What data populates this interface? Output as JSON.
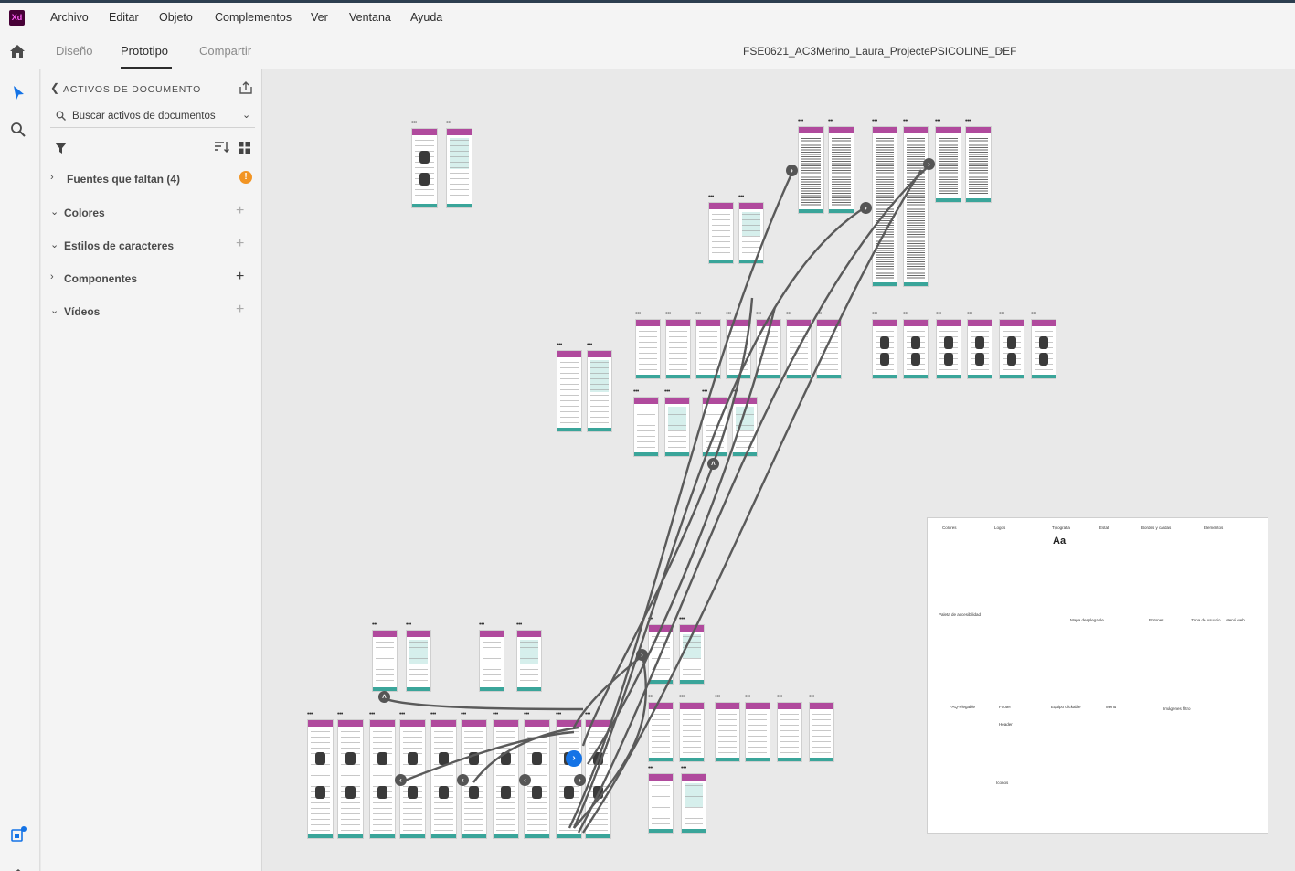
{
  "app": {
    "logo": "Xd"
  },
  "menu": {
    "items": [
      "Archivo",
      "Editar",
      "Objeto",
      "Complementos",
      "Ver",
      "Ventana",
      "Ayuda"
    ]
  },
  "modebar": {
    "tabs": [
      "Diseño",
      "Prototipo",
      "Compartir"
    ],
    "active_tab": "Prototipo",
    "document_title": "FSE0621_AC3Merino_Laura_ProjectePSICOLINE_DEF"
  },
  "assets_panel": {
    "title": "ACTIVOS DE DOCUMENTO",
    "search_placeholder": "Buscar activos de documentos",
    "sections": [
      {
        "label": "Fuentes que faltan (4)",
        "expanded": false,
        "icon": "warning-icon"
      },
      {
        "label": "Colores",
        "expanded": true,
        "icon": "plus-icon"
      },
      {
        "label": "Estilos de caracteres",
        "expanded": true,
        "icon": "plus-icon"
      },
      {
        "label": "Componentes",
        "expanded": false,
        "icon": "plus-icon"
      },
      {
        "label": "Vídeos",
        "expanded": true,
        "icon": "plus-icon"
      }
    ]
  },
  "styleguide": {
    "labels": [
      "Colores",
      "Logos",
      "Tipografia",
      "Estat",
      "Bordes y caídas",
      "Elementos",
      "Paleta de accesibilidad",
      "Mapa desplegable",
      "Botones",
      "Zona de usuario",
      "Menú web",
      "FAQ-Plegable",
      "Footer",
      "Header",
      "Equipo clickable",
      "Menu",
      "Imágenes filtro",
      "Iconos"
    ],
    "typography_sample": "Aa"
  },
  "colors": {
    "brand": "#b04a9d",
    "accent": "#3aa59a",
    "mint": "#d6efec",
    "selection": "#1473e6",
    "warning": "#f29423"
  }
}
